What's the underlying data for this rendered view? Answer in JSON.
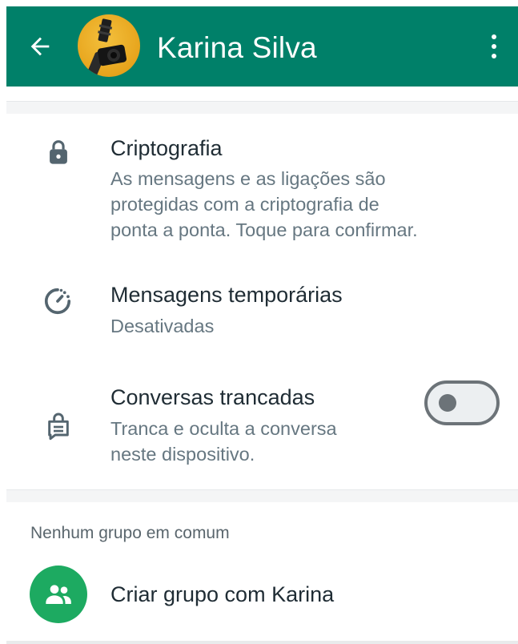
{
  "header": {
    "title": "Karina Silva",
    "background": "#008069",
    "back_icon": "arrow-left-icon",
    "more_icon": "more-vertical-icon"
  },
  "encryption": {
    "icon": "lock-icon",
    "title": "Criptografia",
    "subtitle_lines": [
      "As mensagens e as ligações são",
      "protegidas com a criptografia de",
      "ponta a ponta. Toque para confirmar."
    ]
  },
  "disappearing": {
    "icon": "timer-icon",
    "title": "Mensagens temporárias",
    "subtitle": "Desativadas"
  },
  "chat_lock": {
    "icon": "chat-lock-icon",
    "title": "Conversas trancadas",
    "subtitle_lines": [
      "Tranca e oculta a conversa",
      "neste dispositivo."
    ],
    "toggle_on": false
  },
  "groups": {
    "header": "Nenhum grupo em comum",
    "create_label": "Criar grupo com Karina",
    "create_icon": "group-icon",
    "accent": "#1daa61"
  }
}
